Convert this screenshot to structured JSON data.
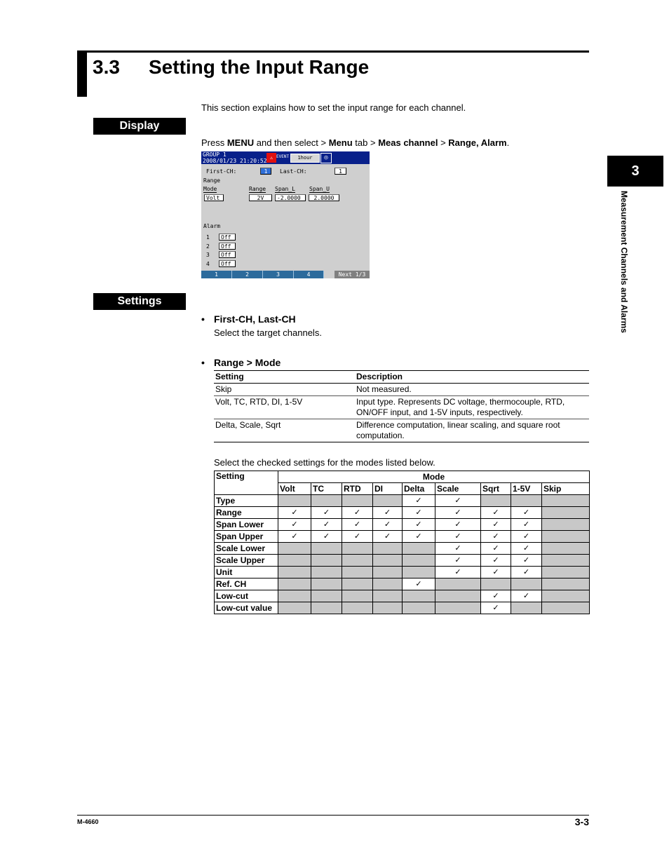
{
  "header": {
    "section_number": "3.3",
    "section_title": "Setting the Input Range"
  },
  "intro": "This section explains how to set the input range for each channel.",
  "display_label": "Display",
  "settings_label": "Settings",
  "press": {
    "p1": "Press ",
    "b1": "MENU",
    "p2": " and then select > ",
    "b2": "Menu",
    "p3": " tab > ",
    "b3": "Meas channel",
    "p4": " > ",
    "b4": "Range, Alarm",
    "p5": "."
  },
  "chapter_tab": {
    "number": "3",
    "title": "Measurement Channels and Alarms"
  },
  "screen": {
    "group": "GROUP 1",
    "datetime": "2008/01/23 21:20:52",
    "fail_icon": "fail-alarm-icon",
    "event_label": "EVENT",
    "time_span": "1hour",
    "first_ch_label": "First-CH:",
    "first_ch_value": "1",
    "last_ch_label": "Last-CH:",
    "last_ch_value": "1",
    "range_heading": "Range",
    "col_mode": "Mode",
    "col_range": "Range",
    "col_span_l": "Span_L",
    "col_span_u": "Span_U",
    "mode_value": "Volt",
    "range_value": "2V",
    "span_l_value": "-2.0000",
    "span_u_value": "2.0000",
    "alarm_heading": "Alarm",
    "alarms": [
      {
        "num": "1",
        "value": "Off"
      },
      {
        "num": "2",
        "value": "Off"
      },
      {
        "num": "3",
        "value": "Off"
      },
      {
        "num": "4",
        "value": "Off"
      }
    ],
    "softkeys": [
      "1",
      "2",
      "3",
      "4"
    ],
    "next": "Next 1/3"
  },
  "bullets": {
    "first_last_title": "First-CH, Last-CH",
    "first_last_desc": "Select the target channels.",
    "range_mode_title": "Range >  Mode",
    "dot": "•"
  },
  "desc_table": {
    "headers": [
      "Setting",
      "Description"
    ],
    "rows": [
      [
        "Skip",
        "Not measured."
      ],
      [
        "Volt, TC, RTD, DI, 1-5V",
        "Input type. Represents DC voltage, thermocouple, RTD, ON/OFF input, and 1-5V inputs, respectively."
      ],
      [
        "Delta, Scale, Sqrt",
        "Difference computation, linear scaling, and square root computation."
      ]
    ]
  },
  "select_text": "Select the checked settings for the modes listed below.",
  "mode_table": {
    "setting_header": "Setting",
    "mode_header": "Mode",
    "modes": [
      "Volt",
      "TC",
      "RTD",
      "DI",
      "Delta",
      "Scale",
      "Sqrt",
      "1-5V",
      "Skip"
    ],
    "check_mark": "✓",
    "rows": [
      {
        "setting": "Type",
        "cells": [
          0,
          0,
          0,
          0,
          1,
          1,
          0,
          0,
          0
        ]
      },
      {
        "setting": "Range",
        "cells": [
          1,
          1,
          1,
          1,
          1,
          1,
          1,
          1,
          0
        ]
      },
      {
        "setting": "Span Lower",
        "cells": [
          1,
          1,
          1,
          1,
          1,
          1,
          1,
          1,
          0
        ]
      },
      {
        "setting": "Span Upper",
        "cells": [
          1,
          1,
          1,
          1,
          1,
          1,
          1,
          1,
          0
        ]
      },
      {
        "setting": "Scale Lower",
        "cells": [
          0,
          0,
          0,
          0,
          0,
          1,
          1,
          1,
          0
        ]
      },
      {
        "setting": "Scale Upper",
        "cells": [
          0,
          0,
          0,
          0,
          0,
          1,
          1,
          1,
          0
        ]
      },
      {
        "setting": "Unit",
        "cells": [
          0,
          0,
          0,
          0,
          0,
          1,
          1,
          1,
          0
        ]
      },
      {
        "setting": "Ref. CH",
        "cells": [
          0,
          0,
          0,
          0,
          1,
          0,
          0,
          0,
          0
        ]
      },
      {
        "setting": "Low-cut",
        "cells": [
          0,
          0,
          0,
          0,
          0,
          0,
          1,
          1,
          0
        ]
      },
      {
        "setting": "Low-cut value",
        "cells": [
          0,
          0,
          0,
          0,
          0,
          0,
          1,
          0,
          0
        ]
      }
    ]
  },
  "footer": {
    "doc_number": "M-4660",
    "page_number": "3-3"
  }
}
